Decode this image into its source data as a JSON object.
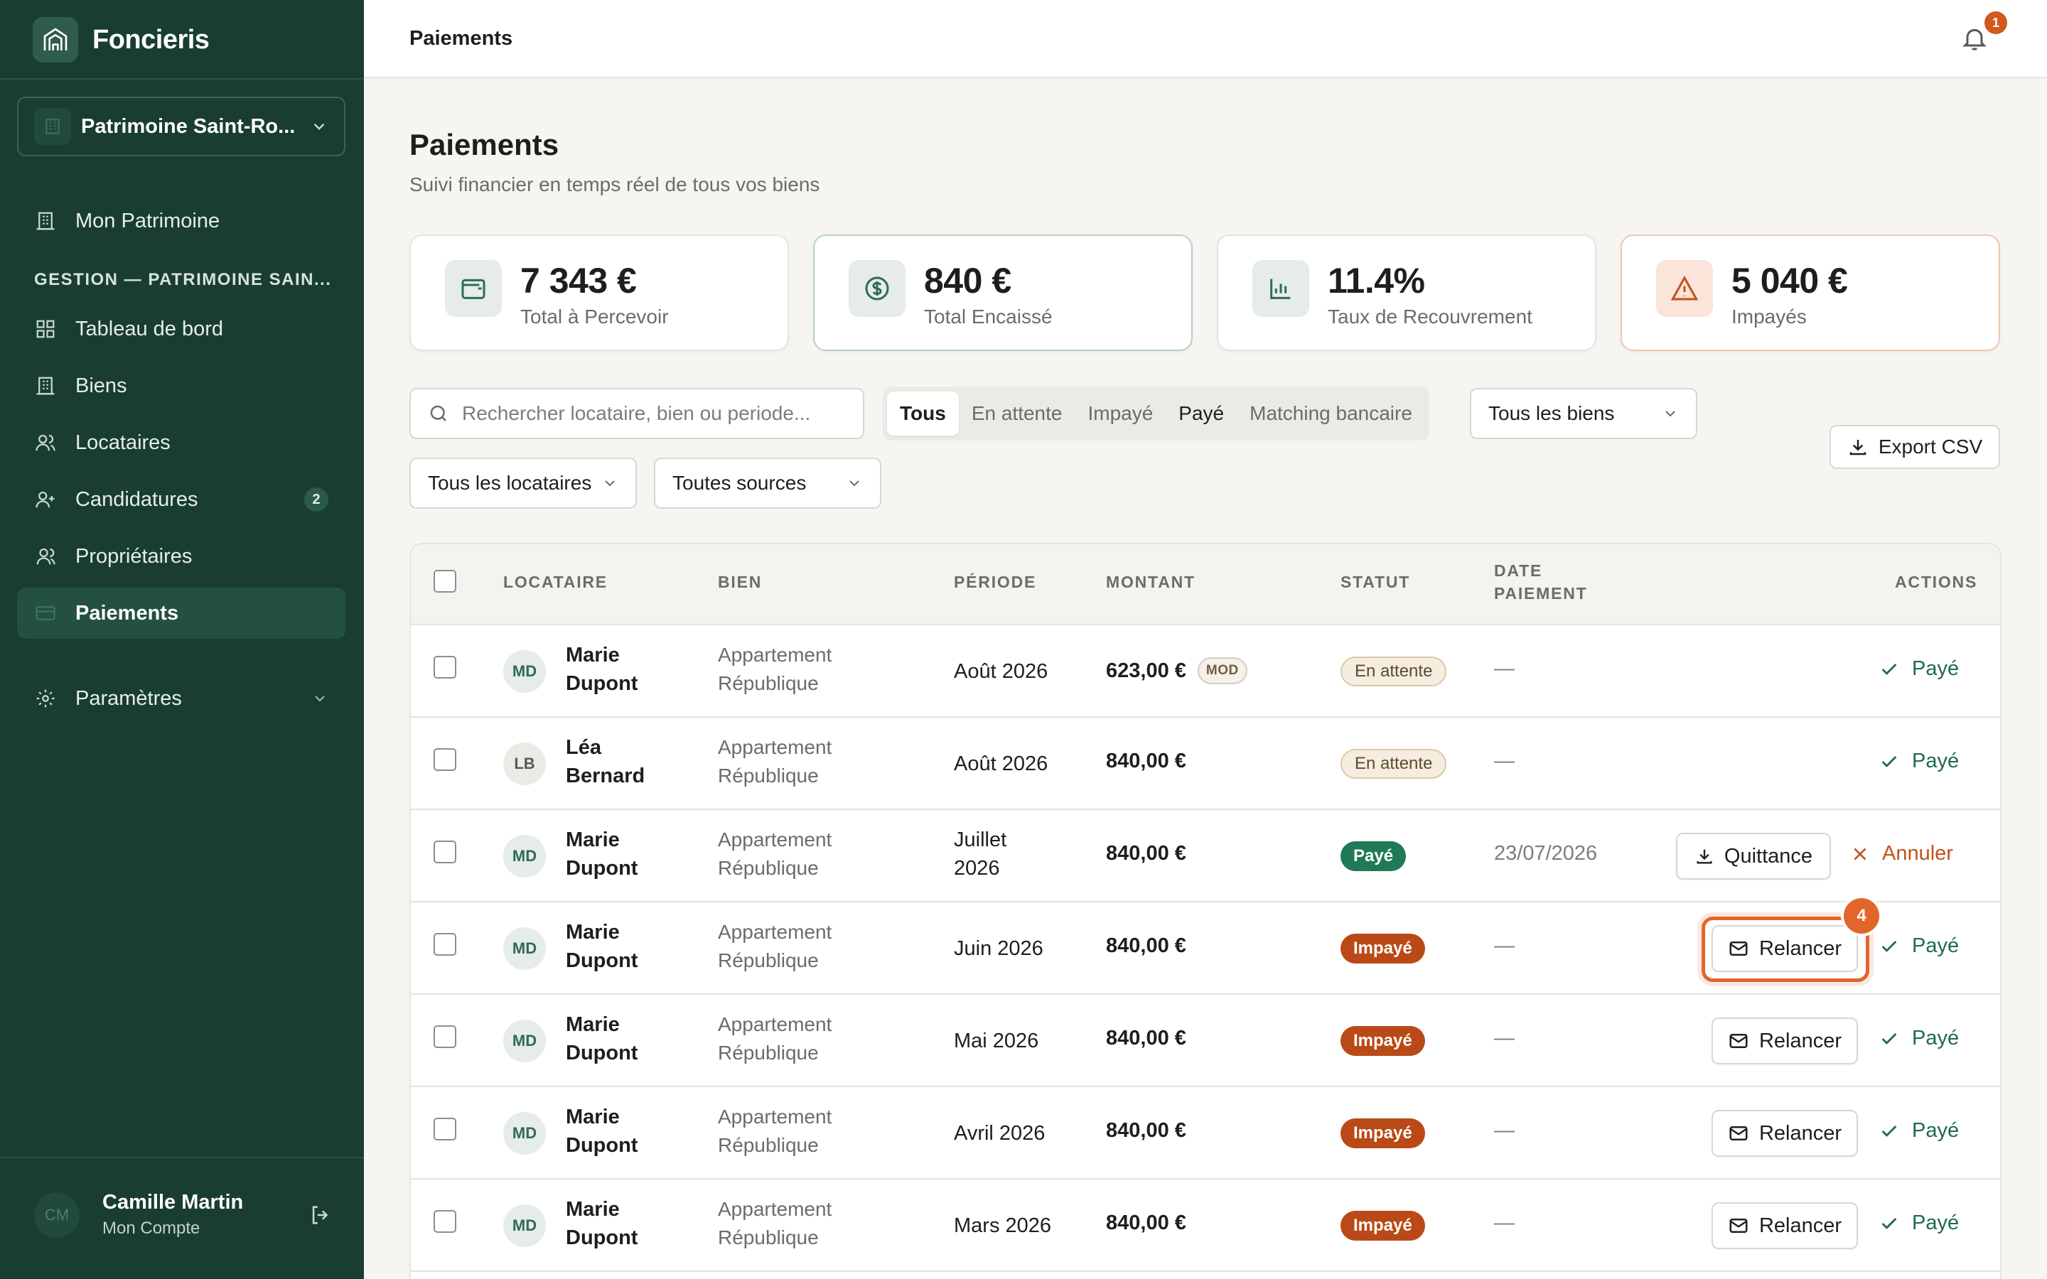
{
  "app": {
    "name": "Foncieris"
  },
  "sidebar": {
    "org_label": "Patrimoine Saint-Ro...",
    "top_item": "Mon Patrimoine",
    "section": "GESTION — PATRIMOINE SAIN...",
    "items": [
      {
        "label": "Tableau de bord",
        "icon": "grid-icon"
      },
      {
        "label": "Biens",
        "icon": "building-icon"
      },
      {
        "label": "Locataires",
        "icon": "users-icon"
      },
      {
        "label": "Candidatures",
        "icon": "user-plus-icon",
        "badge": "2"
      },
      {
        "label": "Propriétaires",
        "icon": "user-icon"
      },
      {
        "label": "Paiements",
        "icon": "card-icon",
        "active": true
      }
    ],
    "settings": "Paramètres",
    "user": {
      "initials": "CM",
      "name": "Camille Martin",
      "sub": "Mon Compte"
    }
  },
  "topbar": {
    "title": "Paiements",
    "notifications": "1"
  },
  "page": {
    "title": "Paiements",
    "subtitle": "Suivi financier en temps réel de tous vos biens"
  },
  "kpis": [
    {
      "value": "7 343 €",
      "label": "Total à Percevoir",
      "icon": "wallet-icon"
    },
    {
      "value": "840 €",
      "label": "Total Encaissé",
      "icon": "dollar-circle-icon"
    },
    {
      "value": "11.4%",
      "label": "Taux de Recouvrement",
      "icon": "bar-chart-icon"
    },
    {
      "value": "5 040 €",
      "label": "Impayés",
      "icon": "warning-icon"
    }
  ],
  "filters": {
    "search_placeholder": "Rechercher locataire, bien ou periode...",
    "tabs": [
      "Tous",
      "En attente",
      "Impayé",
      "Payé",
      "Matching bancaire"
    ],
    "biens": "Tous les biens",
    "locataires": "Tous les locataires",
    "sources": "Toutes sources",
    "export": "Export CSV"
  },
  "table": {
    "headers": {
      "locataire": "LOCATAIRE",
      "bien": "BIEN",
      "periode": "PÉRIODE",
      "montant": "MONTANT",
      "statut": "STATUT",
      "date_l1": "DATE",
      "date_l2": "PAIEMENT",
      "actions": "ACTIONS"
    },
    "rows": [
      {
        "initials": "MD",
        "first": "Marie",
        "last": "Dupont",
        "bien1": "Appartement",
        "bien2": "République",
        "periode": "Août 2026",
        "montant": "623,00 €",
        "tag": "MOD",
        "statut": "En attente",
        "date": "—",
        "paye": "Payé"
      },
      {
        "initials": "LB",
        "first": "Léa",
        "last": "Bernard",
        "bien1": "Appartement",
        "bien2": "République",
        "periode": "Août 2026",
        "montant": "840,00 €",
        "statut": "En attente",
        "date": "—",
        "paye": "Payé"
      },
      {
        "initials": "MD",
        "first": "Marie",
        "last": "Dupont",
        "bien1": "Appartement",
        "bien2": "République",
        "periode_l1": "Juillet",
        "periode_l2": "2026",
        "montant": "840,00 €",
        "statut": "Payé",
        "date": "23/07/2026",
        "quittance": "Quittance",
        "annuler": "Annuler"
      },
      {
        "initials": "MD",
        "first": "Marie",
        "last": "Dupont",
        "bien1": "Appartement",
        "bien2": "République",
        "periode": "Juin 2026",
        "montant": "840,00 €",
        "statut": "Impayé",
        "date": "—",
        "relancer": "Relancer",
        "paye": "Payé",
        "step": "4"
      },
      {
        "initials": "MD",
        "first": "Marie",
        "last": "Dupont",
        "bien1": "Appartement",
        "bien2": "République",
        "periode": "Mai 2026",
        "montant": "840,00 €",
        "statut": "Impayé",
        "date": "—",
        "relancer": "Relancer",
        "paye": "Payé"
      },
      {
        "initials": "MD",
        "first": "Marie",
        "last": "Dupont",
        "bien1": "Appartement",
        "bien2": "République",
        "periode": "Avril 2026",
        "montant": "840,00 €",
        "statut": "Impayé",
        "date": "—",
        "relancer": "Relancer",
        "paye": "Payé"
      },
      {
        "initials": "MD",
        "first": "Marie",
        "last": "Dupont",
        "bien1": "Appartement",
        "bien2": "République",
        "periode": "Mars 2026",
        "montant": "840,00 €",
        "statut": "Impayé",
        "date": "—",
        "relancer": "Relancer",
        "paye": "Payé"
      }
    ]
  },
  "colors": {
    "sidebar": "#193d32",
    "accent": "#1f7a55",
    "danger": "#b94a17",
    "highlight": "#e2652b"
  }
}
